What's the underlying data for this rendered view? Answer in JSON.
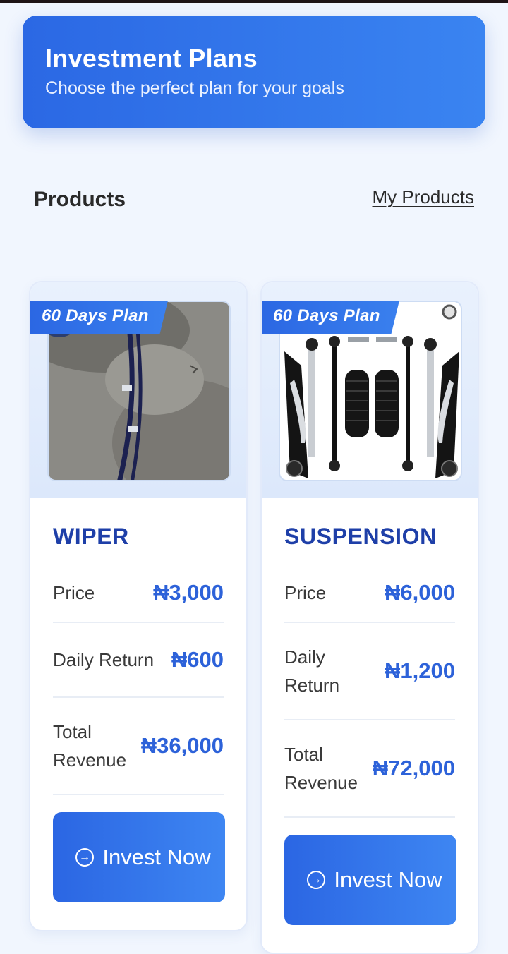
{
  "header": {
    "title": "Investment Plans",
    "subtitle": "Choose the perfect plan for your goals"
  },
  "section": {
    "title": "Products",
    "link": "My Products"
  },
  "labels": {
    "price": "Price",
    "daily_return": "Daily Return",
    "total_revenue": "Total Revenue"
  },
  "products": [
    {
      "plan": "60 Days Plan",
      "name": "WIPER",
      "price": "₦3,000",
      "daily_return": "₦600",
      "total_revenue": "₦36,000",
      "button": "Invest Now"
    },
    {
      "plan": "60 Days Plan",
      "name": "SUSPENSION",
      "price": "₦6,000",
      "daily_return": "₦1,200",
      "total_revenue": "₦72,000",
      "button": "Invest Now"
    }
  ],
  "icons": {
    "invest": "arrow-right-circle-icon"
  },
  "colors": {
    "accent": "#2b66e3",
    "product_name": "#1e3fa8",
    "value": "#2d62d9",
    "background": "#f1f6fe"
  }
}
